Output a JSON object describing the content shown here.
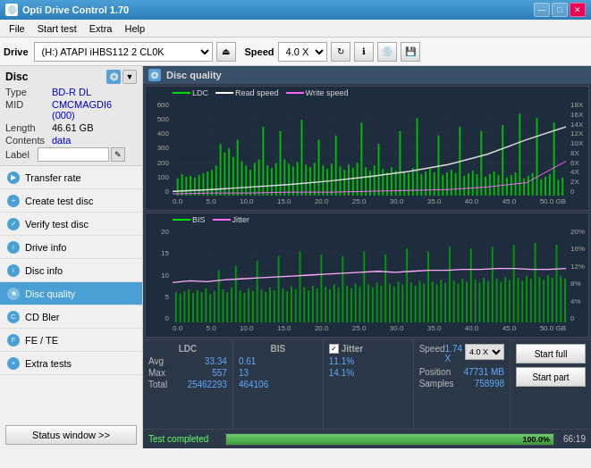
{
  "app": {
    "title": "Opti Drive Control 1.70",
    "icon": "disc-icon"
  },
  "title_controls": {
    "minimize": "—",
    "maximize": "□",
    "close": "✕"
  },
  "menu": {
    "items": [
      "File",
      "Start test",
      "Extra",
      "Help"
    ]
  },
  "toolbar": {
    "drive_label": "Drive",
    "drive_value": "(H:) ATAPI iHBS112  2 CL0K",
    "speed_label": "Speed",
    "speed_value": "4.0 X"
  },
  "disc": {
    "title": "Disc",
    "type_label": "Type",
    "type_value": "BD-R DL",
    "mid_label": "MID",
    "mid_value": "CMCMAGDI6 (000)",
    "length_label": "Length",
    "length_value": "46.61 GB",
    "contents_label": "Contents",
    "contents_value": "data",
    "label_label": "Label",
    "label_value": ""
  },
  "nav": {
    "items": [
      {
        "id": "transfer-rate",
        "label": "Transfer rate",
        "active": false
      },
      {
        "id": "create-test-disc",
        "label": "Create test disc",
        "active": false
      },
      {
        "id": "verify-test-disc",
        "label": "Verify test disc",
        "active": false
      },
      {
        "id": "drive-info",
        "label": "Drive info",
        "active": false
      },
      {
        "id": "disc-info",
        "label": "Disc info",
        "active": false
      },
      {
        "id": "disc-quality",
        "label": "Disc quality",
        "active": true
      },
      {
        "id": "cd-bler",
        "label": "CD Bler",
        "active": false
      },
      {
        "id": "fe-te",
        "label": "FE / TE",
        "active": false
      },
      {
        "id": "extra-tests",
        "label": "Extra tests",
        "active": false
      }
    ]
  },
  "status_window_btn": "Status window >>",
  "content": {
    "icon": "💿",
    "title": "Disc quality"
  },
  "chart_top": {
    "legend": [
      {
        "label": "LDC",
        "color": "#00dd00"
      },
      {
        "label": "Read speed",
        "color": "#ffffff"
      },
      {
        "label": "Write speed",
        "color": "#ff66ff"
      }
    ],
    "y_left": [
      "600",
      "500",
      "400",
      "300",
      "200",
      "100",
      "0"
    ],
    "y_right": [
      "18X",
      "16X",
      "14X",
      "12X",
      "10X",
      "8X",
      "6X",
      "4X",
      "2X",
      "0"
    ],
    "x_labels": [
      "0.0",
      "5.0",
      "10.0",
      "15.0",
      "20.0",
      "25.0",
      "30.0",
      "35.0",
      "40.0",
      "45.0",
      "50.0 GB"
    ]
  },
  "chart_bottom": {
    "legend": [
      {
        "label": "BIS",
        "color": "#00dd00"
      },
      {
        "label": "Jitter",
        "color": "#ff66ff"
      }
    ],
    "y_left": [
      "20",
      "15",
      "10",
      "5",
      "0"
    ],
    "y_right": [
      "20%",
      "16%",
      "12%",
      "8%",
      "4%",
      "0"
    ],
    "x_labels": [
      "0.0",
      "5.0",
      "10.0",
      "15.0",
      "20.0",
      "25.0",
      "30.0",
      "35.0",
      "40.0",
      "45.0",
      "50.0 GB"
    ]
  },
  "stats": {
    "ldc_label": "LDC",
    "bis_label": "BIS",
    "jitter_label": "Jitter",
    "speed_label": "Speed",
    "avg_label": "Avg",
    "max_label": "Max",
    "total_label": "Total",
    "ldc_avg": "33.34",
    "ldc_max": "557",
    "ldc_total": "25462293",
    "bis_avg": "0.61",
    "bis_max": "13",
    "bis_total": "464106",
    "jitter_avg": "11.1%",
    "jitter_max": "14.1%",
    "speed_label2": "Speed",
    "speed_value": "1.74 X",
    "speed_select": "4.0 X",
    "position_label": "Position",
    "position_value": "47731 MB",
    "samples_label": "Samples",
    "samples_value": "758998",
    "start_full_btn": "Start full",
    "start_part_btn": "Start part"
  },
  "progress": {
    "status_text": "Test completed",
    "percent": "100.0%",
    "fill_width": "100",
    "extra_value": "66:19"
  }
}
